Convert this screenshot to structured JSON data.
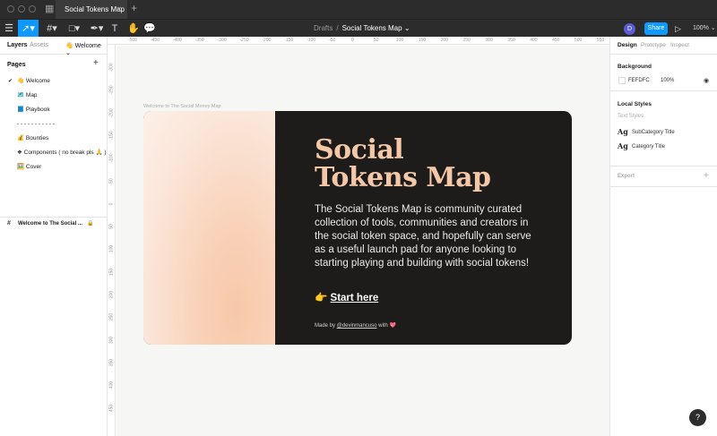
{
  "tab": {
    "title": "Social Tokens Map"
  },
  "breadcrumb": {
    "folder": "Drafts",
    "separator": "/",
    "file": "Social Tokens Map"
  },
  "toolbar": {
    "share_label": "Share",
    "avatar_initial": "D",
    "zoom": "100%"
  },
  "left_panel": {
    "tabs": {
      "layers": "Layers",
      "assets": "Assets",
      "current_page": "👋 Welcome"
    },
    "pages_title": "Pages",
    "pages": [
      {
        "label": "👋 Welcome",
        "active": true
      },
      {
        "label": "🗺️ Map",
        "active": false
      },
      {
        "label": "📘 Playbook",
        "active": false
      },
      {
        "label": "- - - - - - - - - - -",
        "active": false
      },
      {
        "label": "💰 Bounties",
        "active": false
      },
      {
        "label": "❖ Components ( no break pls 🙏 )",
        "active": false
      },
      {
        "label": "🖼️ Cover",
        "active": false
      }
    ],
    "layer": {
      "label": "Welcome to The Social ..."
    }
  },
  "rulers": {
    "top": [
      "-500",
      "-450",
      "-400",
      "-350",
      "-300",
      "-250",
      "-200",
      "-150",
      "-100",
      "-50",
      "0",
      "50",
      "100",
      "150",
      "200",
      "250",
      "300",
      "350",
      "400",
      "450",
      "500",
      "550"
    ],
    "left": [
      "-300",
      "-250",
      "-200",
      "-150",
      "-100",
      "-50",
      "0",
      "50",
      "100",
      "150",
      "200",
      "250",
      "300",
      "350",
      "400",
      "450"
    ]
  },
  "canvas": {
    "frame_label": "Welcome to The Social Money Map",
    "title_lines": [
      "Social",
      "Tokens Map"
    ],
    "body": "The Social Tokens Map is community curated  collection of tools, communities and creators in the social token space, and hopefully can serve as a useful launch pad for anyone looking to starting playing and building with social tokens!",
    "cta_emoji": "👉",
    "cta_link": "Start here",
    "credit_prefix": "Made by",
    "credit_handle": "@devinmancuso",
    "credit_suffix": "with 💖",
    "colors": {
      "frame_bg": "#1d1c1b",
      "title": "#f4c7a6",
      "gradient_a": "#f7c8a8",
      "gradient_b": "#fdf0e8"
    }
  },
  "right_panel": {
    "tabs": {
      "design": "Design",
      "prototype": "Prototype",
      "inspect": "Inspect"
    },
    "background": {
      "title": "Background",
      "hex": "FEFDFC",
      "opacity": "100%"
    },
    "local_styles": {
      "title": "Local Styles",
      "text_styles_label": "Text Styles",
      "styles": [
        {
          "glyph": "Ag",
          "name": "SubCategory Title"
        },
        {
          "glyph": "Ag",
          "name": "Category Title"
        }
      ]
    },
    "export": {
      "title": "Export"
    }
  },
  "help_label": "?"
}
